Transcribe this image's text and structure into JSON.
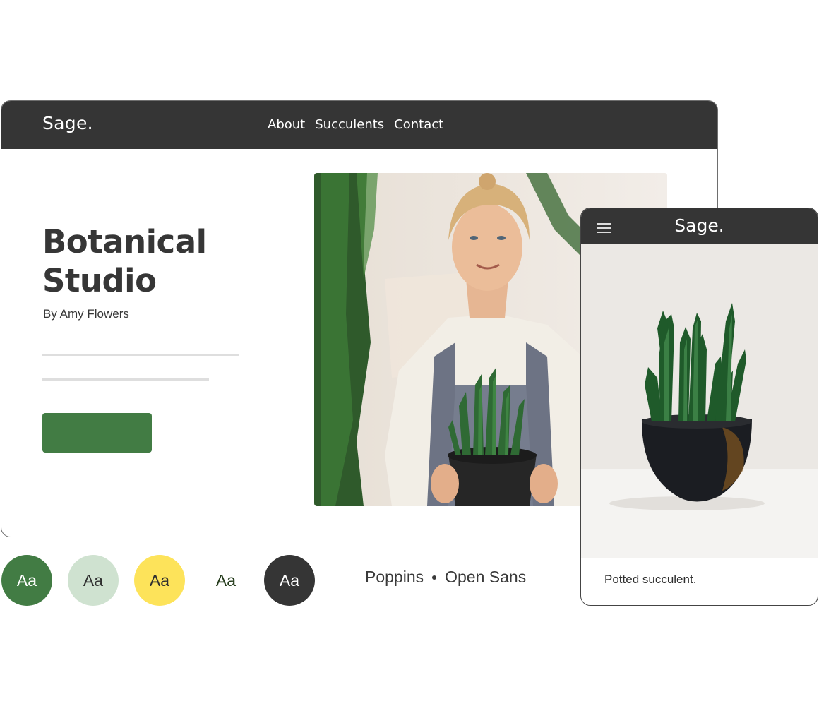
{
  "desktop": {
    "nav": {
      "logo": "Sage.",
      "links": [
        "About",
        "Succulents",
        "Contact"
      ]
    },
    "hero": {
      "title_line1": "Botanical",
      "title_line2": "Studio",
      "subtitle": "By Amy Flowers",
      "cta_color": "#427c44"
    },
    "photo_alt": "Woman in apron holding potted succulent"
  },
  "mobile": {
    "nav": {
      "logo": "Sage.",
      "menu_icon": "hamburger-menu-icon"
    },
    "photo_alt": "Potted succulent in black bowl",
    "caption": "Potted succulent."
  },
  "palette": [
    {
      "label": "Aa",
      "bg": "#427c44",
      "fg": "#ffffff"
    },
    {
      "label": "Aa",
      "bg": "#cfe2d0",
      "fg": "#2f2f2f"
    },
    {
      "label": "Aa",
      "bg": "#fde35a",
      "fg": "#2f2f2f"
    },
    {
      "label": "Aa",
      "bg": "#ffffff",
      "fg": "#233a1a"
    },
    {
      "label": "Aa",
      "bg": "#353535",
      "fg": "#ffffff"
    }
  ],
  "fonts": {
    "primary": "Poppins",
    "secondary": "Open Sans"
  }
}
